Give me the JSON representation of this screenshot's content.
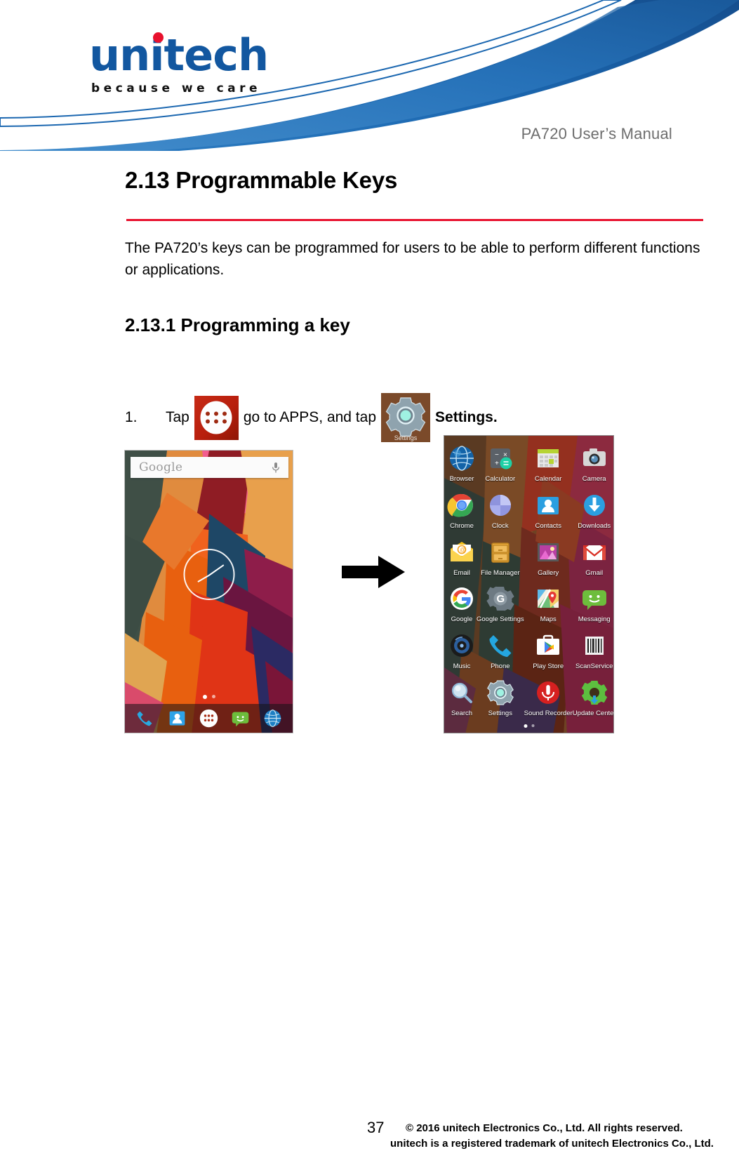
{
  "header": {
    "logo_text": "unitech",
    "logo_tagline": "because we care",
    "manual_title": "PA720 User’s Manual"
  },
  "content": {
    "section_heading": "2.13 Programmable Keys",
    "intro_paragraph": "The PA720’s keys can be programmed for users to be able to perform different functions or applications.",
    "subsection_heading": "2.13.1 Programming a key",
    "step": {
      "number": "1.",
      "text_before_apps_icon": "Tap",
      "text_between": "go to APPS, and tap",
      "text_bold": "Settings.",
      "apps_icon_name": "apps-drawer-icon",
      "settings_icon_name": "settings-gear-icon",
      "settings_icon_label": "Settings"
    }
  },
  "home_screen": {
    "search_placeholder": "Google",
    "mic_icon": "microphone-icon",
    "clock_widget": "analog-clock-widget",
    "page_indicator": [
      "active",
      "inactive"
    ],
    "dock": [
      {
        "name": "phone-icon",
        "label": "Phone"
      },
      {
        "name": "contacts-icon",
        "label": "Contacts"
      },
      {
        "name": "apps-drawer-icon",
        "label": "Apps"
      },
      {
        "name": "messaging-icon",
        "label": "Messaging"
      },
      {
        "name": "browser-icon",
        "label": "Browser"
      }
    ]
  },
  "app_drawer": {
    "page_indicator": [
      "active",
      "inactive"
    ],
    "apps": [
      {
        "label": "Browser",
        "icon": "browser-icon"
      },
      {
        "label": "Calculator",
        "icon": "calculator-icon"
      },
      {
        "label": "Calendar",
        "icon": "calendar-icon"
      },
      {
        "label": "Camera",
        "icon": "camera-icon"
      },
      {
        "label": "Chrome",
        "icon": "chrome-icon"
      },
      {
        "label": "Clock",
        "icon": "clock-icon"
      },
      {
        "label": "Contacts",
        "icon": "contacts-icon"
      },
      {
        "label": "Downloads",
        "icon": "downloads-icon"
      },
      {
        "label": "Email",
        "icon": "email-icon"
      },
      {
        "label": "File Manager",
        "icon": "file-manager-icon"
      },
      {
        "label": "Gallery",
        "icon": "gallery-icon"
      },
      {
        "label": "Gmail",
        "icon": "gmail-icon"
      },
      {
        "label": "Google",
        "icon": "google-icon"
      },
      {
        "label": "Google Settings",
        "icon": "google-settings-icon"
      },
      {
        "label": "Maps",
        "icon": "maps-icon"
      },
      {
        "label": "Messaging",
        "icon": "messaging-icon"
      },
      {
        "label": "Music",
        "icon": "music-icon"
      },
      {
        "label": "Phone",
        "icon": "phone-icon"
      },
      {
        "label": "Play Store",
        "icon": "play-store-icon"
      },
      {
        "label": "ScanService",
        "icon": "scan-service-icon"
      },
      {
        "label": "Search",
        "icon": "search-icon"
      },
      {
        "label": "Settings",
        "icon": "settings-gear-icon"
      },
      {
        "label": "Sound Recorder",
        "icon": "sound-recorder-icon"
      },
      {
        "label": "Update Center",
        "icon": "update-center-icon"
      }
    ]
  },
  "flow": {
    "arrow_icon": "right-arrow-icon"
  },
  "footer": {
    "page_number": "37",
    "copyright_line1": "© 2016 unitech Electronics Co., Ltd. All rights reserved.",
    "copyright_line2": "unitech is a registered trademark of unitech Electronics Co., Ltd."
  },
  "colors": {
    "brand_blue": "#1257a0",
    "brand_red": "#e8112d",
    "rule_red": "#e8112d",
    "manual_title_gray": "#6d6d6d"
  }
}
